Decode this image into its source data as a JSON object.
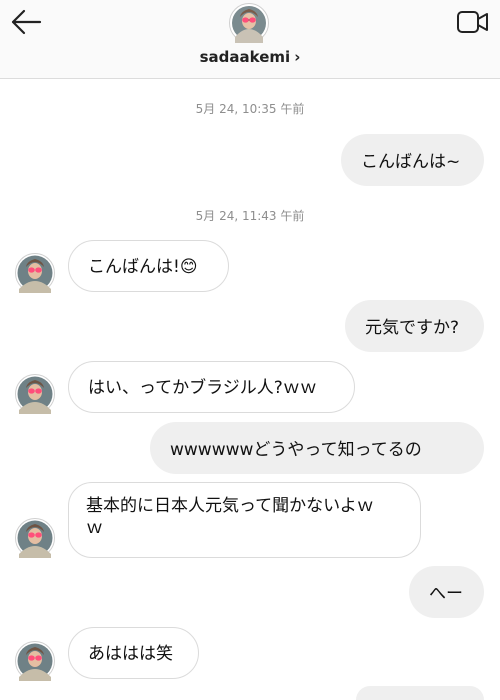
{
  "header": {
    "username": "sadaakemi",
    "chevron": "›",
    "back_icon": "arrow-left-icon",
    "video_icon": "video-camera-icon"
  },
  "timestamps": [
    "5月 24, 10:35 午前",
    "5月 24, 11:43 午前"
  ],
  "messages": [
    {
      "from": "me",
      "text": "こんばんは~"
    },
    {
      "from": "them",
      "text": "こんばんは!😊"
    },
    {
      "from": "me",
      "text": "元気ですか?"
    },
    {
      "from": "them",
      "text": "はい、ってかブラジル人?ｗｗ"
    },
    {
      "from": "me",
      "text": "wwwwwwどうやって知ってるの"
    },
    {
      "from": "them",
      "text": "基本的に日本人元気って聞かないよｗ\nｗ"
    },
    {
      "from": "me",
      "text": "へー"
    },
    {
      "from": "them",
      "text": "あははは笑"
    }
  ],
  "colors": {
    "sent_bubble": "#efefef",
    "received_border": "#dbdbdb",
    "timestamp": "#8e8e8e",
    "header_bg": "#fafafa"
  }
}
